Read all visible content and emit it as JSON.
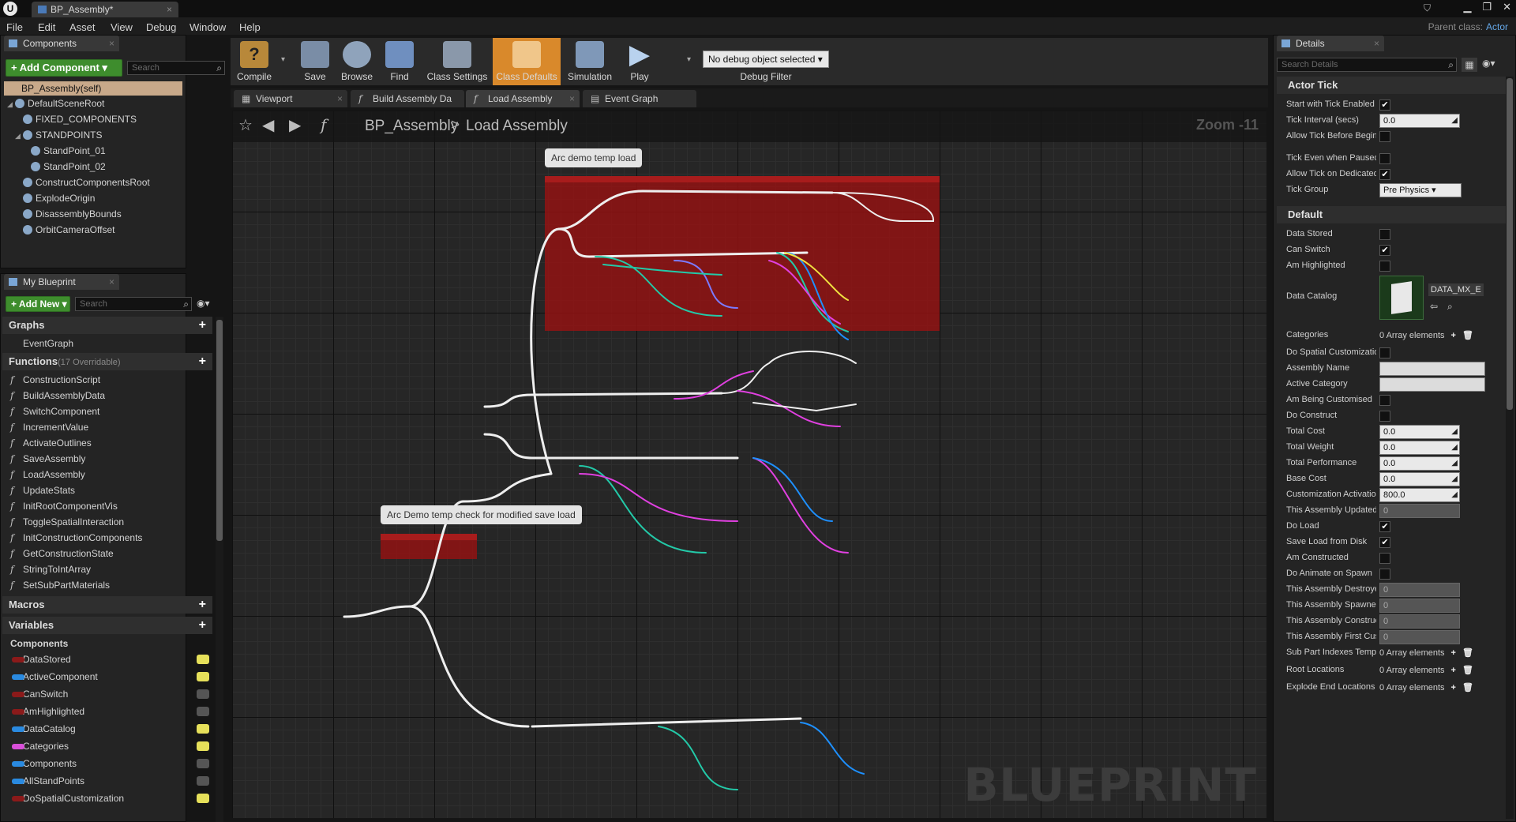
{
  "titlebar": {
    "doc_tab": "BP_Assembly*",
    "logo": "U"
  },
  "menu": [
    "File",
    "Edit",
    "Asset",
    "View",
    "Debug",
    "Window",
    "Help"
  ],
  "parent_class": {
    "label": "Parent class:",
    "value": "Actor"
  },
  "components_panel": {
    "tab": "Components",
    "add_button": "+ Add Component ▾",
    "search_placeholder": "Search",
    "self_item": "BP_Assembly(self)",
    "tree": [
      {
        "label": "DefaultSceneRoot",
        "indent": 0,
        "expand": "◢"
      },
      {
        "label": "FIXED_COMPONENTS",
        "indent": 1,
        "expand": ""
      },
      {
        "label": "STANDPOINTS",
        "indent": 1,
        "expand": "◢"
      },
      {
        "label": "StandPoint_01",
        "indent": 2,
        "expand": ""
      },
      {
        "label": "StandPoint_02",
        "indent": 2,
        "expand": ""
      },
      {
        "label": "ConstructComponentsRoot",
        "indent": 1,
        "expand": ""
      },
      {
        "label": "ExplodeOrigin",
        "indent": 1,
        "expand": ""
      },
      {
        "label": "DisassemblyBounds",
        "indent": 1,
        "expand": ""
      },
      {
        "label": "OrbitCameraOffset",
        "indent": 1,
        "expand": ""
      }
    ]
  },
  "my_blueprint": {
    "tab": "My Blueprint",
    "add_button": "+ Add New ▾",
    "search_placeholder": "Search",
    "graphs_header": "Graphs",
    "graphs": [
      "EventGraph"
    ],
    "functions_header": "Functions",
    "functions_sub": "(17 Overridable)",
    "functions": [
      "ConstructionScript",
      "BuildAssemblyData",
      "SwitchComponent",
      "IncrementValue",
      "ActivateOutlines",
      "SaveAssembly",
      "LoadAssembly",
      "UpdateStats",
      "InitRootComponentVis",
      "ToggleSpatialInteraction",
      "InitConstructionComponents",
      "GetConstructionState",
      "StringToIntArray",
      "SetSubPartMaterials"
    ],
    "macros_header": "Macros",
    "variables_header": "Variables",
    "components_category": "Components",
    "variables": [
      {
        "name": "DataStored",
        "color": "#8b1a1a",
        "visible": true
      },
      {
        "name": "ActiveComponent",
        "color": "#2a8ae0",
        "visible": true
      },
      {
        "name": "CanSwitch",
        "color": "#8b1a1a",
        "visible": false
      },
      {
        "name": "AmHighlighted",
        "color": "#8b1a1a",
        "visible": false
      },
      {
        "name": "DataCatalog",
        "color": "#2a8ae0",
        "visible": true
      },
      {
        "name": "Categories",
        "color": "#d94fd9",
        "visible": true
      },
      {
        "name": "Components",
        "color": "#2a8ae0",
        "visible": false
      },
      {
        "name": "AllStandPoints",
        "color": "#2a8ae0",
        "visible": false
      },
      {
        "name": "DoSpatialCustomization",
        "color": "#8b1a1a",
        "visible": true
      }
    ]
  },
  "toolbar": {
    "buttons": [
      "Compile",
      "Save",
      "Browse",
      "Find",
      "Class Settings",
      "Class Defaults",
      "Simulation",
      "Play"
    ],
    "debug_select": "No debug object selected ▾",
    "debug_filter": "Debug Filter"
  },
  "doc_tabs": [
    "Viewport",
    "Build Assembly Da",
    "Load Assembly",
    "Event Graph"
  ],
  "graph": {
    "crumb_root": "BP_Assembly",
    "crumb_sep": ">",
    "crumb_leaf": "Load Assembly",
    "zoom": "Zoom -11",
    "watermark": "BLUEPRINT",
    "comments": [
      "Arc demo temp load",
      "Arc Demo temp check for modified save load"
    ]
  },
  "details": {
    "tab": "Details",
    "search_placeholder": "Search Details",
    "actor_tick_header": "Actor Tick",
    "default_header": "Default",
    "actor_tick": [
      {
        "label": "Start with Tick Enabled",
        "kind": "check",
        "value": "✔"
      },
      {
        "label": "Tick Interval (secs)",
        "kind": "num",
        "value": "0.0"
      },
      {
        "label": "Allow Tick Before Begin Play",
        "kind": "check",
        "value": ""
      },
      {
        "label": "Tick Even when Paused",
        "kind": "check",
        "value": ""
      },
      {
        "label": "Allow Tick on Dedicated Server",
        "kind": "check",
        "value": "✔"
      },
      {
        "label": "Tick Group",
        "kind": "select",
        "value": "Pre Physics ▾"
      }
    ],
    "data_catalog": {
      "label": "Data Catalog",
      "value": "DATA_MX_E ▾"
    },
    "default_rows": [
      {
        "label": "Data Stored",
        "kind": "check",
        "value": ""
      },
      {
        "label": "Can Switch",
        "kind": "check",
        "value": "✔"
      },
      {
        "label": "Am Highlighted",
        "kind": "check",
        "value": ""
      },
      {
        "label": "Categories",
        "kind": "arr",
        "value": "0 Array elements"
      },
      {
        "label": "Do Spatial Customization",
        "kind": "check",
        "value": ""
      },
      {
        "label": "Assembly Name",
        "kind": "text",
        "value": ""
      },
      {
        "label": "Active Category",
        "kind": "text",
        "value": ""
      },
      {
        "label": "Am Being Customised",
        "kind": "check",
        "value": ""
      },
      {
        "label": "Do Construct",
        "kind": "check",
        "value": ""
      },
      {
        "label": "Total Cost",
        "kind": "num",
        "value": "0.0"
      },
      {
        "label": "Total Weight",
        "kind": "num",
        "value": "0.0"
      },
      {
        "label": "Total Performance",
        "kind": "num",
        "value": "0.0"
      },
      {
        "label": "Base Cost",
        "kind": "num",
        "value": "0.0"
      },
      {
        "label": "Customization Activation",
        "kind": "num",
        "value": "800.0"
      },
      {
        "label": "This Assembly Updated",
        "kind": "dis",
        "value": "0"
      },
      {
        "label": "Do Load",
        "kind": "check",
        "value": "✔"
      },
      {
        "label": "Save Load from Disk",
        "kind": "check",
        "value": "✔"
      },
      {
        "label": "Am Constructed",
        "kind": "check",
        "value": ""
      },
      {
        "label": "Do Animate on Spawn",
        "kind": "check",
        "value": ""
      },
      {
        "label": "This Assembly Destroyed",
        "kind": "dis",
        "value": "0"
      },
      {
        "label": "This Assembly Spawned",
        "kind": "dis",
        "value": "0"
      },
      {
        "label": "This Assembly Constructed",
        "kind": "dis",
        "value": "0"
      },
      {
        "label": "This Assembly First Cust",
        "kind": "dis",
        "value": "0"
      },
      {
        "label": "Sub Part Indexes Template",
        "kind": "arr",
        "value": "0 Array elements"
      },
      {
        "label": "Root Locations",
        "kind": "arr",
        "value": "0 Array elements"
      },
      {
        "label": "Explode End Locations",
        "kind": "arr",
        "value": "0 Array elements"
      }
    ]
  },
  "colors": {
    "accent_orange": "#d9892b",
    "comment_red": "#a71c1c",
    "add_green": "#3e8d2d"
  }
}
